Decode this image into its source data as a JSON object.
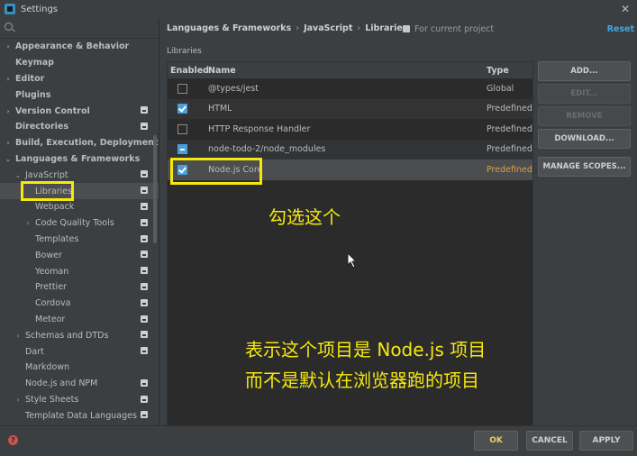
{
  "window": {
    "title": "Settings"
  },
  "search": {
    "placeholder": ""
  },
  "sidebar": {
    "items": [
      {
        "label": "Appearance & Behavior",
        "arrow": "›",
        "indent": 0,
        "bold": true,
        "project": false
      },
      {
        "label": "Keymap",
        "arrow": "",
        "indent": 0,
        "bold": true,
        "project": false
      },
      {
        "label": "Editor",
        "arrow": "›",
        "indent": 0,
        "bold": true,
        "project": false
      },
      {
        "label": "Plugins",
        "arrow": "",
        "indent": 0,
        "bold": true,
        "project": false
      },
      {
        "label": "Version Control",
        "arrow": "›",
        "indent": 0,
        "bold": true,
        "project": true
      },
      {
        "label": "Directories",
        "arrow": "",
        "indent": 0,
        "bold": true,
        "project": true
      },
      {
        "label": "Build, Execution, Deployment",
        "arrow": "›",
        "indent": 0,
        "bold": true,
        "project": false
      },
      {
        "label": "Languages & Frameworks",
        "arrow": "⌄",
        "indent": 0,
        "bold": true,
        "project": false
      },
      {
        "label": "JavaScript",
        "arrow": "⌄",
        "indent": 1,
        "bold": false,
        "project": true
      },
      {
        "label": "Libraries",
        "arrow": "",
        "indent": 2,
        "bold": false,
        "project": true,
        "selected": true
      },
      {
        "label": "Webpack",
        "arrow": "",
        "indent": 2,
        "bold": false,
        "project": true
      },
      {
        "label": "Code Quality Tools",
        "arrow": "›",
        "indent": 2,
        "bold": false,
        "project": true
      },
      {
        "label": "Templates",
        "arrow": "",
        "indent": 2,
        "bold": false,
        "project": true
      },
      {
        "label": "Bower",
        "arrow": "",
        "indent": 2,
        "bold": false,
        "project": true
      },
      {
        "label": "Yeoman",
        "arrow": "",
        "indent": 2,
        "bold": false,
        "project": true
      },
      {
        "label": "Prettier",
        "arrow": "",
        "indent": 2,
        "bold": false,
        "project": true
      },
      {
        "label": "Cordova",
        "arrow": "",
        "indent": 2,
        "bold": false,
        "project": true
      },
      {
        "label": "Meteor",
        "arrow": "",
        "indent": 2,
        "bold": false,
        "project": true
      },
      {
        "label": "Schemas and DTDs",
        "arrow": "›",
        "indent": 1,
        "bold": false,
        "project": true
      },
      {
        "label": "Dart",
        "arrow": "",
        "indent": 1,
        "bold": false,
        "project": true
      },
      {
        "label": "Markdown",
        "arrow": "",
        "indent": 1,
        "bold": false,
        "project": false
      },
      {
        "label": "Node.js and NPM",
        "arrow": "",
        "indent": 1,
        "bold": false,
        "project": true
      },
      {
        "label": "Style Sheets",
        "arrow": "›",
        "indent": 1,
        "bold": false,
        "project": true
      },
      {
        "label": "Template Data Languages",
        "arrow": "",
        "indent": 1,
        "bold": false,
        "project": true
      }
    ]
  },
  "header": {
    "breadcrumb": [
      "Languages & Frameworks",
      "JavaScript",
      "Libraries"
    ],
    "breadcrumb_sep": "›",
    "scope": "For current project",
    "reset": "Reset"
  },
  "libraries": {
    "section_label": "Libraries",
    "columns": {
      "enabled": "Enabled",
      "name": "Name",
      "level": "Type"
    },
    "rows": [
      {
        "state": "unchecked",
        "name": "@types/jest",
        "level": "Global"
      },
      {
        "state": "checked",
        "name": "HTML",
        "level": "Predefined"
      },
      {
        "state": "unchecked",
        "name": "HTTP Response Handler",
        "level": "Predefined"
      },
      {
        "state": "partial",
        "name": "node-todo-2/node_modules",
        "level": "Predefined"
      },
      {
        "state": "checked",
        "name": "Node.js Core",
        "level": "Predefined",
        "selected": true
      }
    ]
  },
  "actions": {
    "add": "ADD...",
    "edit": "EDIT...",
    "remove": "REMOVE",
    "download": "DOWNLOAD...",
    "manage_scopes": "MANAGE SCOPES..."
  },
  "annotations": {
    "check_this": "勾选这个",
    "line1": "表示这个项目是 Node.js 项目",
    "line2": "而不是默认在浏览器跑的项目"
  },
  "footer": {
    "help": "?",
    "ok": "OK",
    "cancel": "CANCEL",
    "apply": "APPLY"
  },
  "colors": {
    "accent": "#4a9eda",
    "highlight": "#f5e80f",
    "reset_link": "#3ca8e0"
  }
}
